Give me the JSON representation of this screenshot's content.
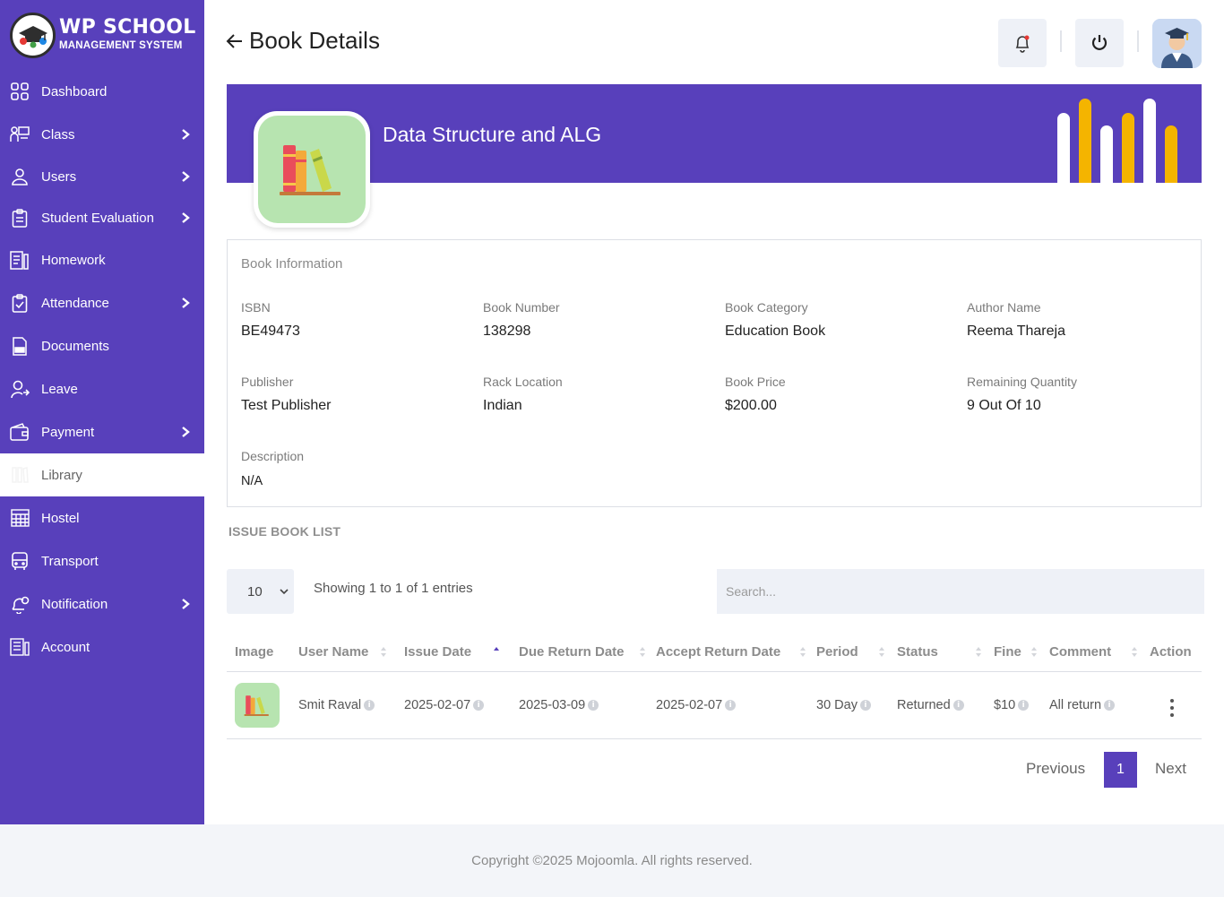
{
  "sidebar": {
    "logo_title": "WP SCHOOL",
    "logo_subtitle": "MANAGEMENT SYSTEM",
    "items": [
      {
        "label": "Dashboard",
        "icon": "dashboard-icon",
        "has_arrow": false
      },
      {
        "label": "Class",
        "icon": "class-icon",
        "has_arrow": true
      },
      {
        "label": "Users",
        "icon": "user-icon",
        "has_arrow": true
      },
      {
        "label": "Student Evaluation",
        "icon": "clipboard-icon",
        "has_arrow": true
      },
      {
        "label": "Homework",
        "icon": "homework-icon",
        "has_arrow": false
      },
      {
        "label": "Attendance",
        "icon": "attendance-icon",
        "has_arrow": true
      },
      {
        "label": "Documents",
        "icon": "document-icon",
        "has_arrow": false
      },
      {
        "label": "Leave",
        "icon": "leave-icon",
        "has_arrow": false
      },
      {
        "label": "Payment",
        "icon": "wallet-icon",
        "has_arrow": true
      },
      {
        "label": "Library",
        "icon": "library-icon",
        "has_arrow": false,
        "active": true
      },
      {
        "label": "Hostel",
        "icon": "hostel-icon",
        "has_arrow": false
      },
      {
        "label": "Transport",
        "icon": "bus-icon",
        "has_arrow": false
      },
      {
        "label": "Notification",
        "icon": "bell-icon",
        "has_arrow": true
      },
      {
        "label": "Account",
        "icon": "account-icon",
        "has_arrow": false
      }
    ]
  },
  "header": {
    "title": "Book Details",
    "notification_icon": "bell-icon",
    "power_icon": "power-icon"
  },
  "banner": {
    "book_title": "Data Structure and ALG"
  },
  "book_info": {
    "heading": "Book Information",
    "isbn_label": "ISBN",
    "isbn": "BE49473",
    "book_number_label": "Book Number",
    "book_number": "138298",
    "category_label": "Book Category",
    "category": "Education Book",
    "author_label": "Author Name",
    "author": "Reema Thareja",
    "publisher_label": "Publisher",
    "publisher": "Test Publisher",
    "rack_label": "Rack Location",
    "rack": "Indian",
    "price_label": "Book Price",
    "price": "$200.00",
    "remaining_label": "Remaining Quantity",
    "remaining": "9 Out Of 10",
    "description_label": "Description",
    "description": "N/A"
  },
  "issue_list": {
    "title": "ISSUE BOOK LIST",
    "page_length": "10",
    "showing": "Showing 1 to 1 of 1 entries",
    "search_placeholder": "Search...",
    "columns": [
      "Image",
      "User Name",
      "Issue Date",
      "Due Return Date",
      "Accept Return Date",
      "Period",
      "Status",
      "Fine",
      "Comment",
      "Action"
    ],
    "rows": [
      {
        "user": "Smit Raval",
        "issue_date": "2025-02-07",
        "due_date": "2025-03-09",
        "accept_date": "2025-02-07",
        "period": "30 Day",
        "status": "Returned",
        "fine": "$10",
        "comment": "All return"
      }
    ],
    "pagination": {
      "previous": "Previous",
      "current": "1",
      "next": "Next"
    }
  },
  "footer": {
    "copyright": "Copyright ©2025 Mojoomla. All rights reserved."
  },
  "colors": {
    "brand": "#5840bb",
    "accent_yellow": "#f4b400",
    "book_tile_bg": "#b7e4b0"
  }
}
